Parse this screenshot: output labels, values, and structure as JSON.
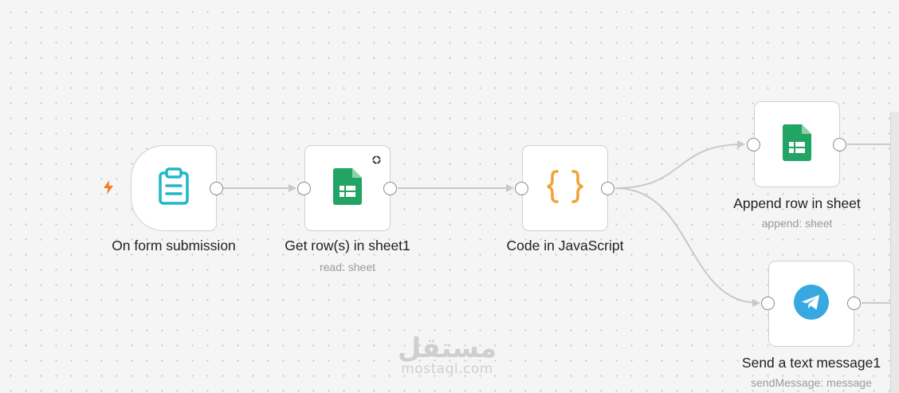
{
  "nodes": {
    "form_trigger": {
      "label": "On form submission",
      "icon": "clipboard-icon"
    },
    "get_rows": {
      "label": "Get row(s) in sheet1",
      "sublabel": "read: sheet",
      "icon": "google-sheets-icon"
    },
    "code_js": {
      "label": "Code in JavaScript",
      "icon": "code-braces-icon"
    },
    "append_row": {
      "label": "Append row in sheet",
      "sublabel": "append: sheet",
      "icon": "google-sheets-icon"
    },
    "telegram": {
      "label": "Send a text message1",
      "sublabel": "sendMessage: message",
      "icon": "telegram-icon"
    }
  },
  "watermark": {
    "arabic": "مستقل",
    "latin": "mostaql.com"
  },
  "colors": {
    "trigger_bolt": "#f57c1f",
    "form_icon": "#1fb8c4",
    "sheets_green": "#21a464",
    "code_orange": "#f2a238",
    "telegram_blue": "#38a8e0",
    "edge": "#c9c9c9"
  }
}
